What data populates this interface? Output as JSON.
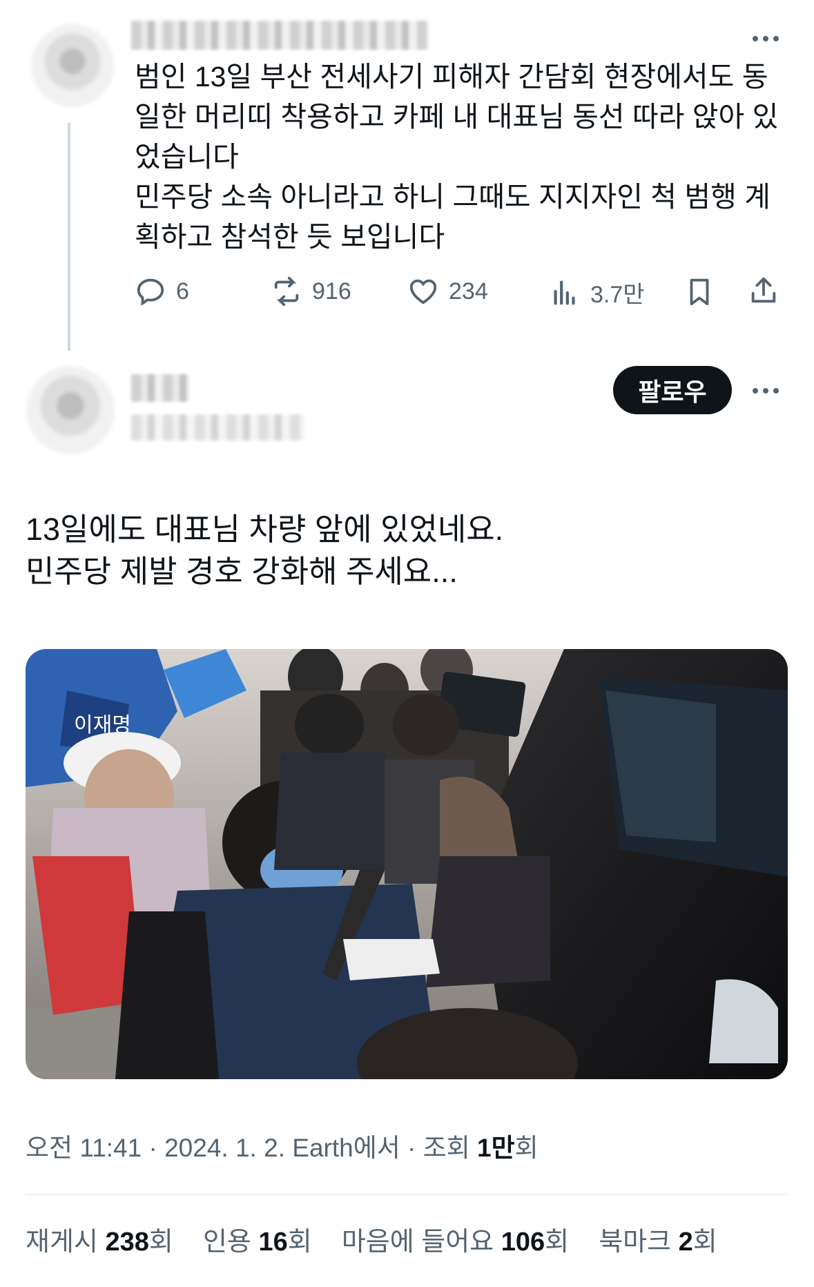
{
  "reply": {
    "text_lines": [
      "범인 13일 부산 전세사기 피해자 간담회 현장에서도 동",
      "일한 머리띠 착용하고 카페 내 대표님 동선 따라 앉아 있",
      "었습니다",
      "민주당 소속 아니라고 하니 그때도 지지자인 척 범행 계",
      "획하고 참석한 듯 보입니다"
    ],
    "actions": {
      "replies": "6",
      "reposts": "916",
      "likes": "234",
      "views": "3.7만"
    },
    "icons": [
      "reply-icon",
      "repost-icon",
      "like-icon",
      "views-icon",
      "bookmark-icon",
      "share-icon"
    ]
  },
  "main": {
    "follow_label": "팔로우",
    "text_lines": [
      "13일에도 대표님 차량 앞에 있었네요.",
      "민주당 제발 경호 강화해 주세요..."
    ],
    "photo_sign_text": "이재명\nLI",
    "meta": {
      "time": "오전 11:41",
      "sep1": " · ",
      "date": "2024. 1. 2.",
      "source": " Earth에서",
      "sep2": " · ",
      "views_label": "조회 ",
      "views_value": "1만",
      "views_suffix": "회"
    },
    "stats": {
      "reposts_label": "재게시 ",
      "reposts_value": "238",
      "reposts_suffix": "회",
      "quotes_label": "인용 ",
      "quotes_value": "16",
      "quotes_suffix": "회",
      "likes_label": "마음에 들어요 ",
      "likes_value": "106",
      "likes_suffix": "회",
      "bookmarks_label": "북마크 ",
      "bookmarks_value": "2",
      "bookmarks_suffix": "회"
    }
  },
  "colors": {
    "text": "#0f1419",
    "secondary": "#536471",
    "thread_line": "#cfd9de",
    "button_bg": "#0f1419"
  }
}
